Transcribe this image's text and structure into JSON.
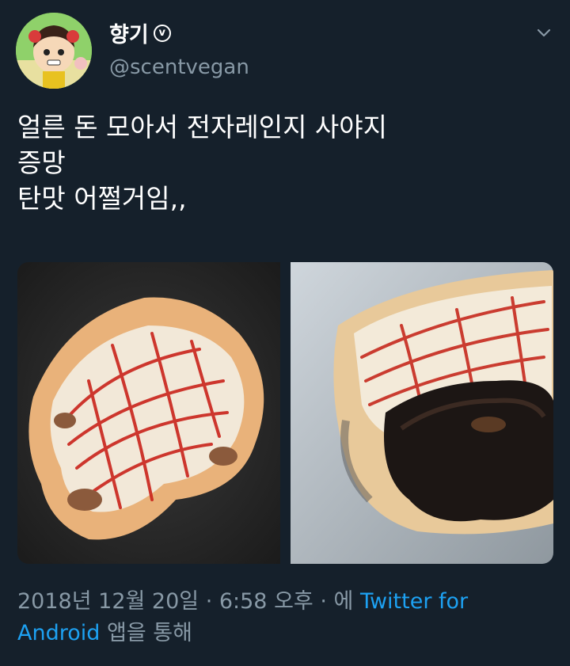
{
  "tweet": {
    "display_name": "향기",
    "verified_glyph": "v",
    "handle": "@scentvegan",
    "menu_icon": "chevron-down-icon",
    "text_lines": [
      "얼른 돈 모아서 전자레인지 사야지",
      "증망",
      "탄맛 어쩔거임,,"
    ],
    "media": [
      {
        "icon": "photo-pizza-bread"
      },
      {
        "icon": "photo-burnt-pizza-bread"
      }
    ],
    "meta": {
      "timestamp": "2018년 12월 20일 · 6:58 오후 · 에 ",
      "source_link": "Twitter for Android",
      "suffix": " 앱을 통해"
    }
  },
  "colors": {
    "background": "#15202b",
    "secondary_text": "#8899a6",
    "link": "#1da1f2"
  }
}
